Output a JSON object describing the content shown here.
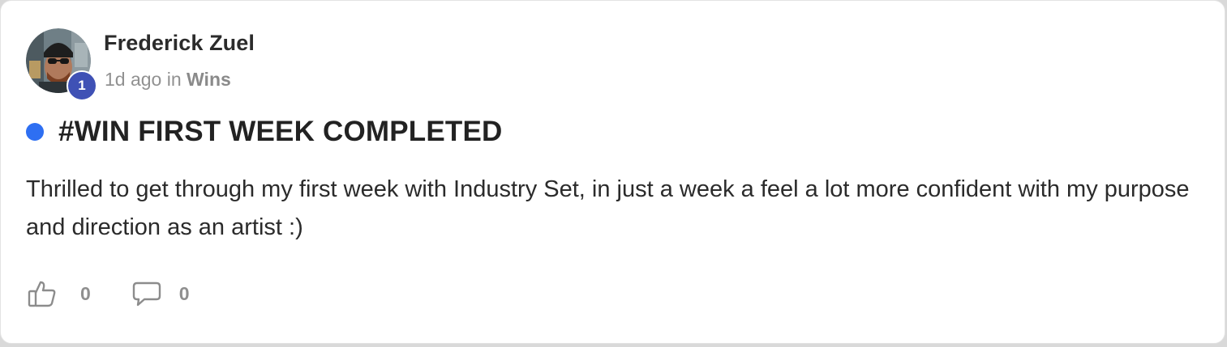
{
  "post": {
    "author": {
      "name": "Frederick Zuel",
      "level": "1"
    },
    "time_ago": "1d ago",
    "in_label": "in",
    "category": "Wins",
    "unread": true,
    "title": "#WIN FIRST WEEK COMPLETED",
    "body": "Thrilled to get through my first week with Industry Set, in just a week a feel a lot more confident with my purpose and direction as an artist :)",
    "likes": "0",
    "comments": "0"
  },
  "icons": {
    "like": "thumbs-up-icon",
    "comment": "comment-bubble-icon"
  },
  "colors": {
    "unread_dot": "#2e6ff2",
    "level_badge": "#3f51b5",
    "meta_text": "#919191"
  }
}
